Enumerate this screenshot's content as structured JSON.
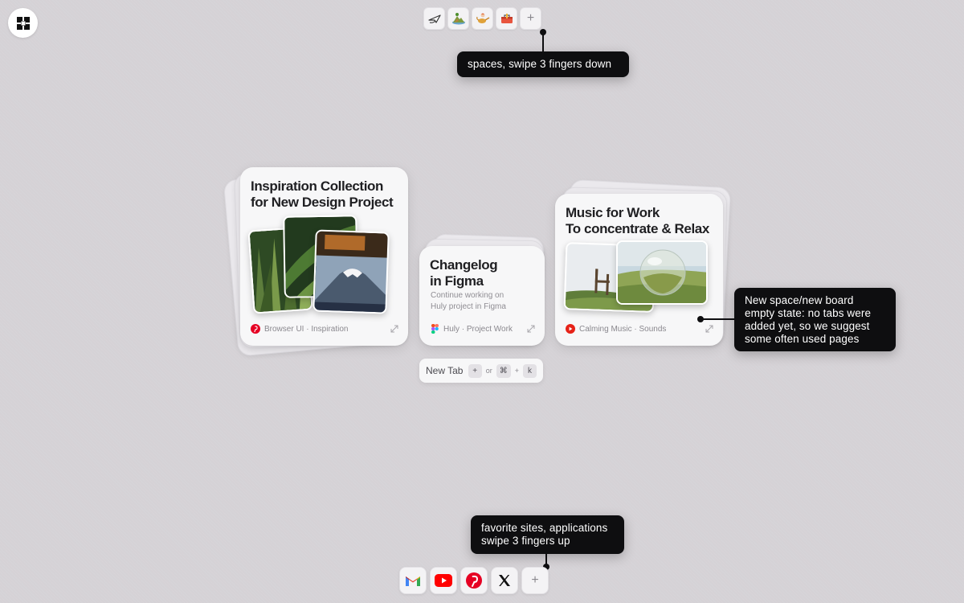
{
  "spaces": {
    "items": [
      {
        "name": "paper-plane-icon"
      },
      {
        "name": "island-icon"
      },
      {
        "name": "genie-lamp-icon"
      },
      {
        "name": "toolbox-icon"
      }
    ],
    "add_label": "+"
  },
  "tooltips": {
    "spaces": "spaces, swipe 3 fingers down",
    "empty_state": [
      "New space/new board",
      "empty state: no tabs were",
      "added yet, so we suggest",
      "some often used pages"
    ],
    "favorites": [
      "favorite sites, applications",
      "swipe 3 fingers up"
    ]
  },
  "cards": [
    {
      "title": "Inspiration Collection\nfor New Design Project",
      "source": "Browser UI · Inspiration",
      "icon": "pinterest-icon"
    },
    {
      "title": "Changelog\nin Figma",
      "description": "Continue working on\nHuly project in Figma",
      "source": "Huly · Project Work",
      "icon": "figma-icon"
    },
    {
      "title": "Music for Work\nTo concentrate & Relax",
      "source": "Calming Music · Sounds",
      "icon": "youtube-icon"
    }
  ],
  "new_tab": {
    "label": "New Tab",
    "key_plus": "+",
    "or": "or",
    "cmd": "⌘",
    "join": "+",
    "key_k": "k"
  },
  "dock": {
    "items": [
      {
        "name": "gmail-icon"
      },
      {
        "name": "youtube-icon"
      },
      {
        "name": "pinterest-icon"
      },
      {
        "name": "x-icon"
      }
    ],
    "add_label": "+"
  },
  "colors": {
    "background": "#d5d2d6",
    "tooltip": "#0e0e10",
    "pinterest": "#e60023",
    "youtube": "#ff0000",
    "gmail_red": "#ea4335"
  }
}
